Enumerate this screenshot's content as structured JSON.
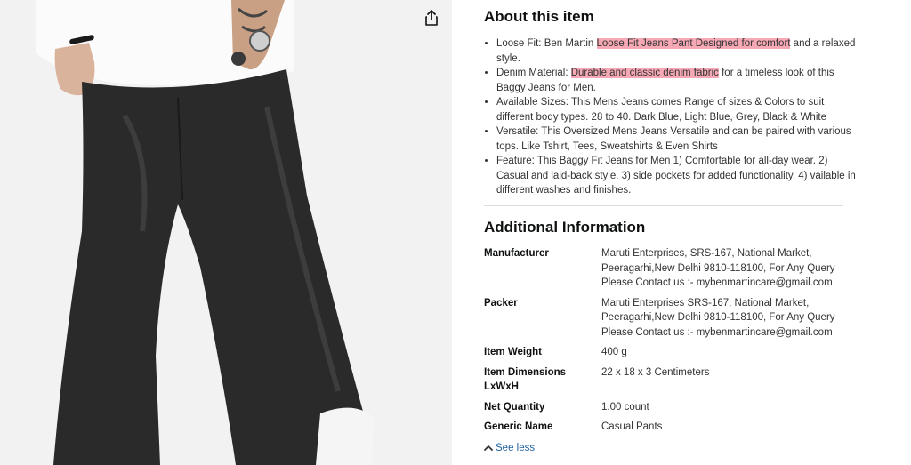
{
  "about": {
    "title": "About this item",
    "bullets": [
      {
        "pre": "Loose Fit: Ben Martin ",
        "hl": "Loose Fit Jeans Pant Designed for comfort",
        "post": " and a relaxed style."
      },
      {
        "pre": "Denim Material: ",
        "hl": "Durable and classic denim fabric",
        "post": " for a timeless look of this Baggy Jeans for Men."
      },
      {
        "text": "Available Sizes: This Mens Jeans comes Range of sizes & Colors to suit different body types. 28 to 40. Dark Blue, Light Blue, Grey, Black & White"
      },
      {
        "text": "Versatile: This Oversized Mens Jeans Versatile and can be paired with various tops. Like Tshirt, Tees, Sweatshirts & Even Shirts"
      },
      {
        "text": "Feature: This Baggy Fit Jeans for Men 1) Comfortable for all-day wear. 2) Casual and laid-back style. 3) side pockets for added functionality. 4) vailable in different washes and finishes."
      }
    ]
  },
  "additional": {
    "title": "Additional Information",
    "rows": [
      {
        "label": "Manufacturer",
        "value": "Maruti Enterprises, SRS-167, National Market, Peeragarhi,New Delhi 9810-118100, For Any Query Please Contact us :- mybenmartincare@gmail.com"
      },
      {
        "label": "Packer",
        "value": "Maruti Enterprises SRS-167, National Market, Peeragarhi,New Delhi 9810-118100, For Any Query Please Contact us :- mybenmartincare@gmail.com"
      },
      {
        "label": "Item Weight",
        "value": "400 g"
      },
      {
        "label": "Item Dimensions LxWxH",
        "value": "22 x 18 x 3 Centimeters"
      },
      {
        "label": "Net Quantity",
        "value": "1.00 count"
      },
      {
        "label": "Generic Name",
        "value": "Casual Pants"
      }
    ]
  },
  "see_less": {
    "label": "See less",
    "icon": "chevron-up-icon"
  },
  "share": {
    "icon": "share-icon"
  },
  "colors": {
    "highlight": "#f7a8b5",
    "link": "#2162a1",
    "image_bg": "#f2f2f2",
    "jeans": "#2a2a2a"
  }
}
